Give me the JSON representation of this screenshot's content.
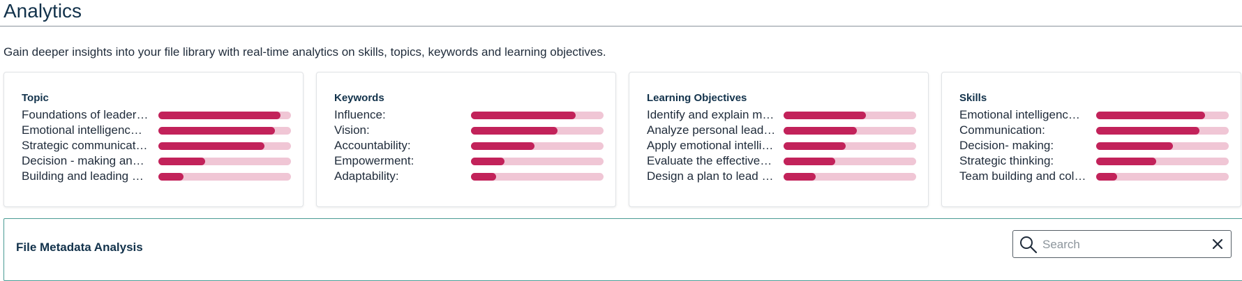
{
  "header": {
    "title": "Analytics",
    "description": "Gain deeper insights into your file library with real-time analytics on skills, topics, keywords and learning objectives."
  },
  "cards": [
    {
      "title": "Topic",
      "items": [
        {
          "label": "Foundations of leader…",
          "value": 0.92
        },
        {
          "label": "Emotional intelligenc…",
          "value": 0.88
        },
        {
          "label": "Strategic communicat…",
          "value": 0.8
        },
        {
          "label": "Decision - making an…",
          "value": 0.35
        },
        {
          "label": "Building and leading …",
          "value": 0.19
        }
      ]
    },
    {
      "title": "Keywords",
      "items": [
        {
          "label": "Influence:",
          "value": 0.79
        },
        {
          "label": "Vision:",
          "value": 0.65
        },
        {
          "label": "Accountability:",
          "value": 0.48
        },
        {
          "label": "Empowerment:",
          "value": 0.25
        },
        {
          "label": "Adaptability:",
          "value": 0.19
        }
      ]
    },
    {
      "title": "Learning Objectives",
      "items": [
        {
          "label": "Identify and explain m…",
          "value": 0.62
        },
        {
          "label": "Analyze personal lead…",
          "value": 0.55
        },
        {
          "label": "Apply emotional intelli…",
          "value": 0.47
        },
        {
          "label": "Evaluate the effective…",
          "value": 0.39
        },
        {
          "label": "Design a plan to lead …",
          "value": 0.24
        }
      ]
    },
    {
      "title": "Skills",
      "items": [
        {
          "label": "Emotional intelligenc…",
          "value": 0.82
        },
        {
          "label": "Communication:",
          "value": 0.78
        },
        {
          "label": "Decision- making:",
          "value": 0.58
        },
        {
          "label": "Strategic thinking:",
          "value": 0.45
        },
        {
          "label": "Team building and col…",
          "value": 0.16
        }
      ]
    }
  ],
  "metadata": {
    "title": "File Metadata Analysis",
    "search": {
      "placeholder": "Search",
      "value": ""
    }
  },
  "colors": {
    "bar_fill": "#c2225a",
    "bar_track": "#f0c6d5",
    "panel_border": "#4a9b93"
  },
  "icons": {
    "search": "search-icon",
    "clear": "close-icon"
  }
}
